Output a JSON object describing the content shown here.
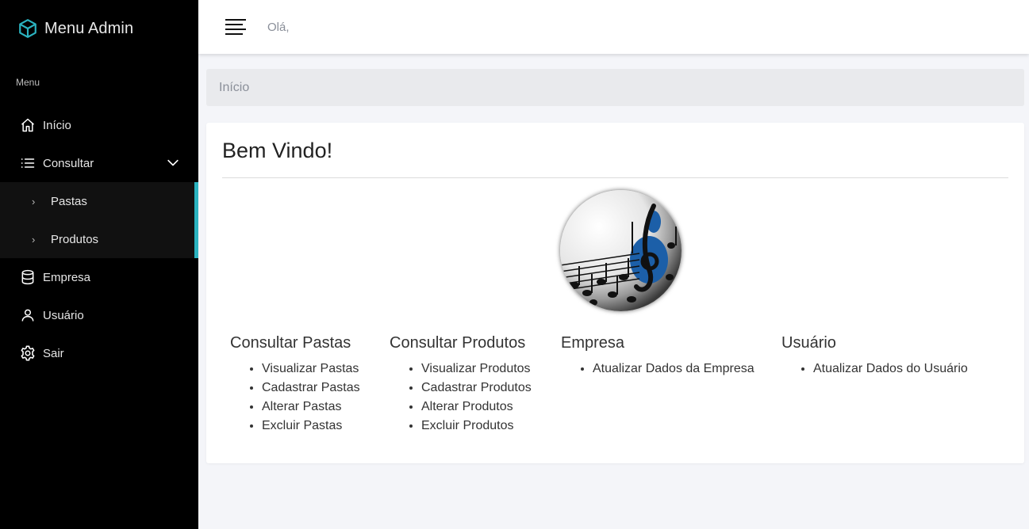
{
  "sidebar": {
    "brand": "Menu Admin",
    "brand_icon": "cube-icon",
    "menu_header": "Menu",
    "items": [
      {
        "label": "Início",
        "icon": "home-icon"
      },
      {
        "label": "Consultar",
        "icon": "list-icon"
      },
      {
        "label": "Empresa",
        "icon": "database-icon"
      },
      {
        "label": "Usuário",
        "icon": "user-icon"
      },
      {
        "label": "Sair",
        "icon": "gear-icon"
      }
    ],
    "subitems": [
      {
        "label": "Pastas"
      },
      {
        "label": "Produtos"
      }
    ],
    "accent_color": "#2bb3c0"
  },
  "topbar": {
    "greeting": "Olá,"
  },
  "breadcrumb": {
    "current": "Início"
  },
  "card": {
    "title": "Bem Vindo!",
    "sections": [
      {
        "title": "Consultar Pastas",
        "links": [
          "Visualizar Pastas",
          "Cadastrar Pastas",
          "Alterar Pastas",
          "Excluir Pastas"
        ]
      },
      {
        "title": "Consultar Produtos",
        "links": [
          "Visualizar Produtos",
          "Cadastrar Produtos",
          "Alterar Produtos",
          "Excluir Produtos"
        ]
      },
      {
        "title": "Empresa",
        "links": [
          "Atualizar Dados da Empresa"
        ]
      },
      {
        "title": "Usuário",
        "links": [
          "Atualizar Dados do Usuário"
        ]
      }
    ]
  }
}
